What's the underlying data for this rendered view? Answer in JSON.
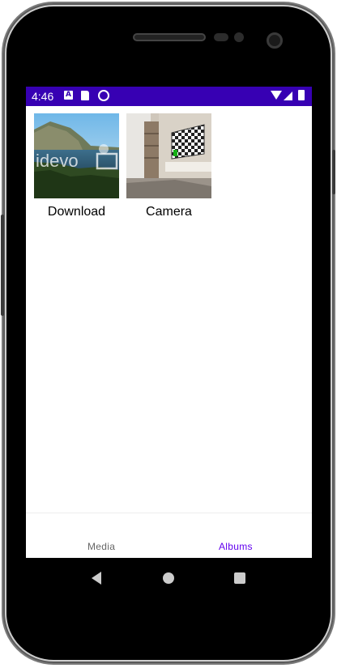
{
  "status_bar": {
    "time": "4:46",
    "icons": [
      "a-notification-icon",
      "sd-card-icon",
      "sync-icon",
      "wifi-icon",
      "signal-icon",
      "battery-icon"
    ],
    "background_color": "#3700b3"
  },
  "albums": [
    {
      "name": "Download"
    },
    {
      "name": "Camera"
    }
  ],
  "bottom_nav": {
    "items": [
      {
        "label": "Media",
        "selected": false
      },
      {
        "label": "Albums",
        "selected": true
      }
    ],
    "active_color": "#6200ee"
  },
  "system_nav": {
    "icons": [
      "back-icon",
      "home-icon",
      "recents-icon"
    ]
  }
}
